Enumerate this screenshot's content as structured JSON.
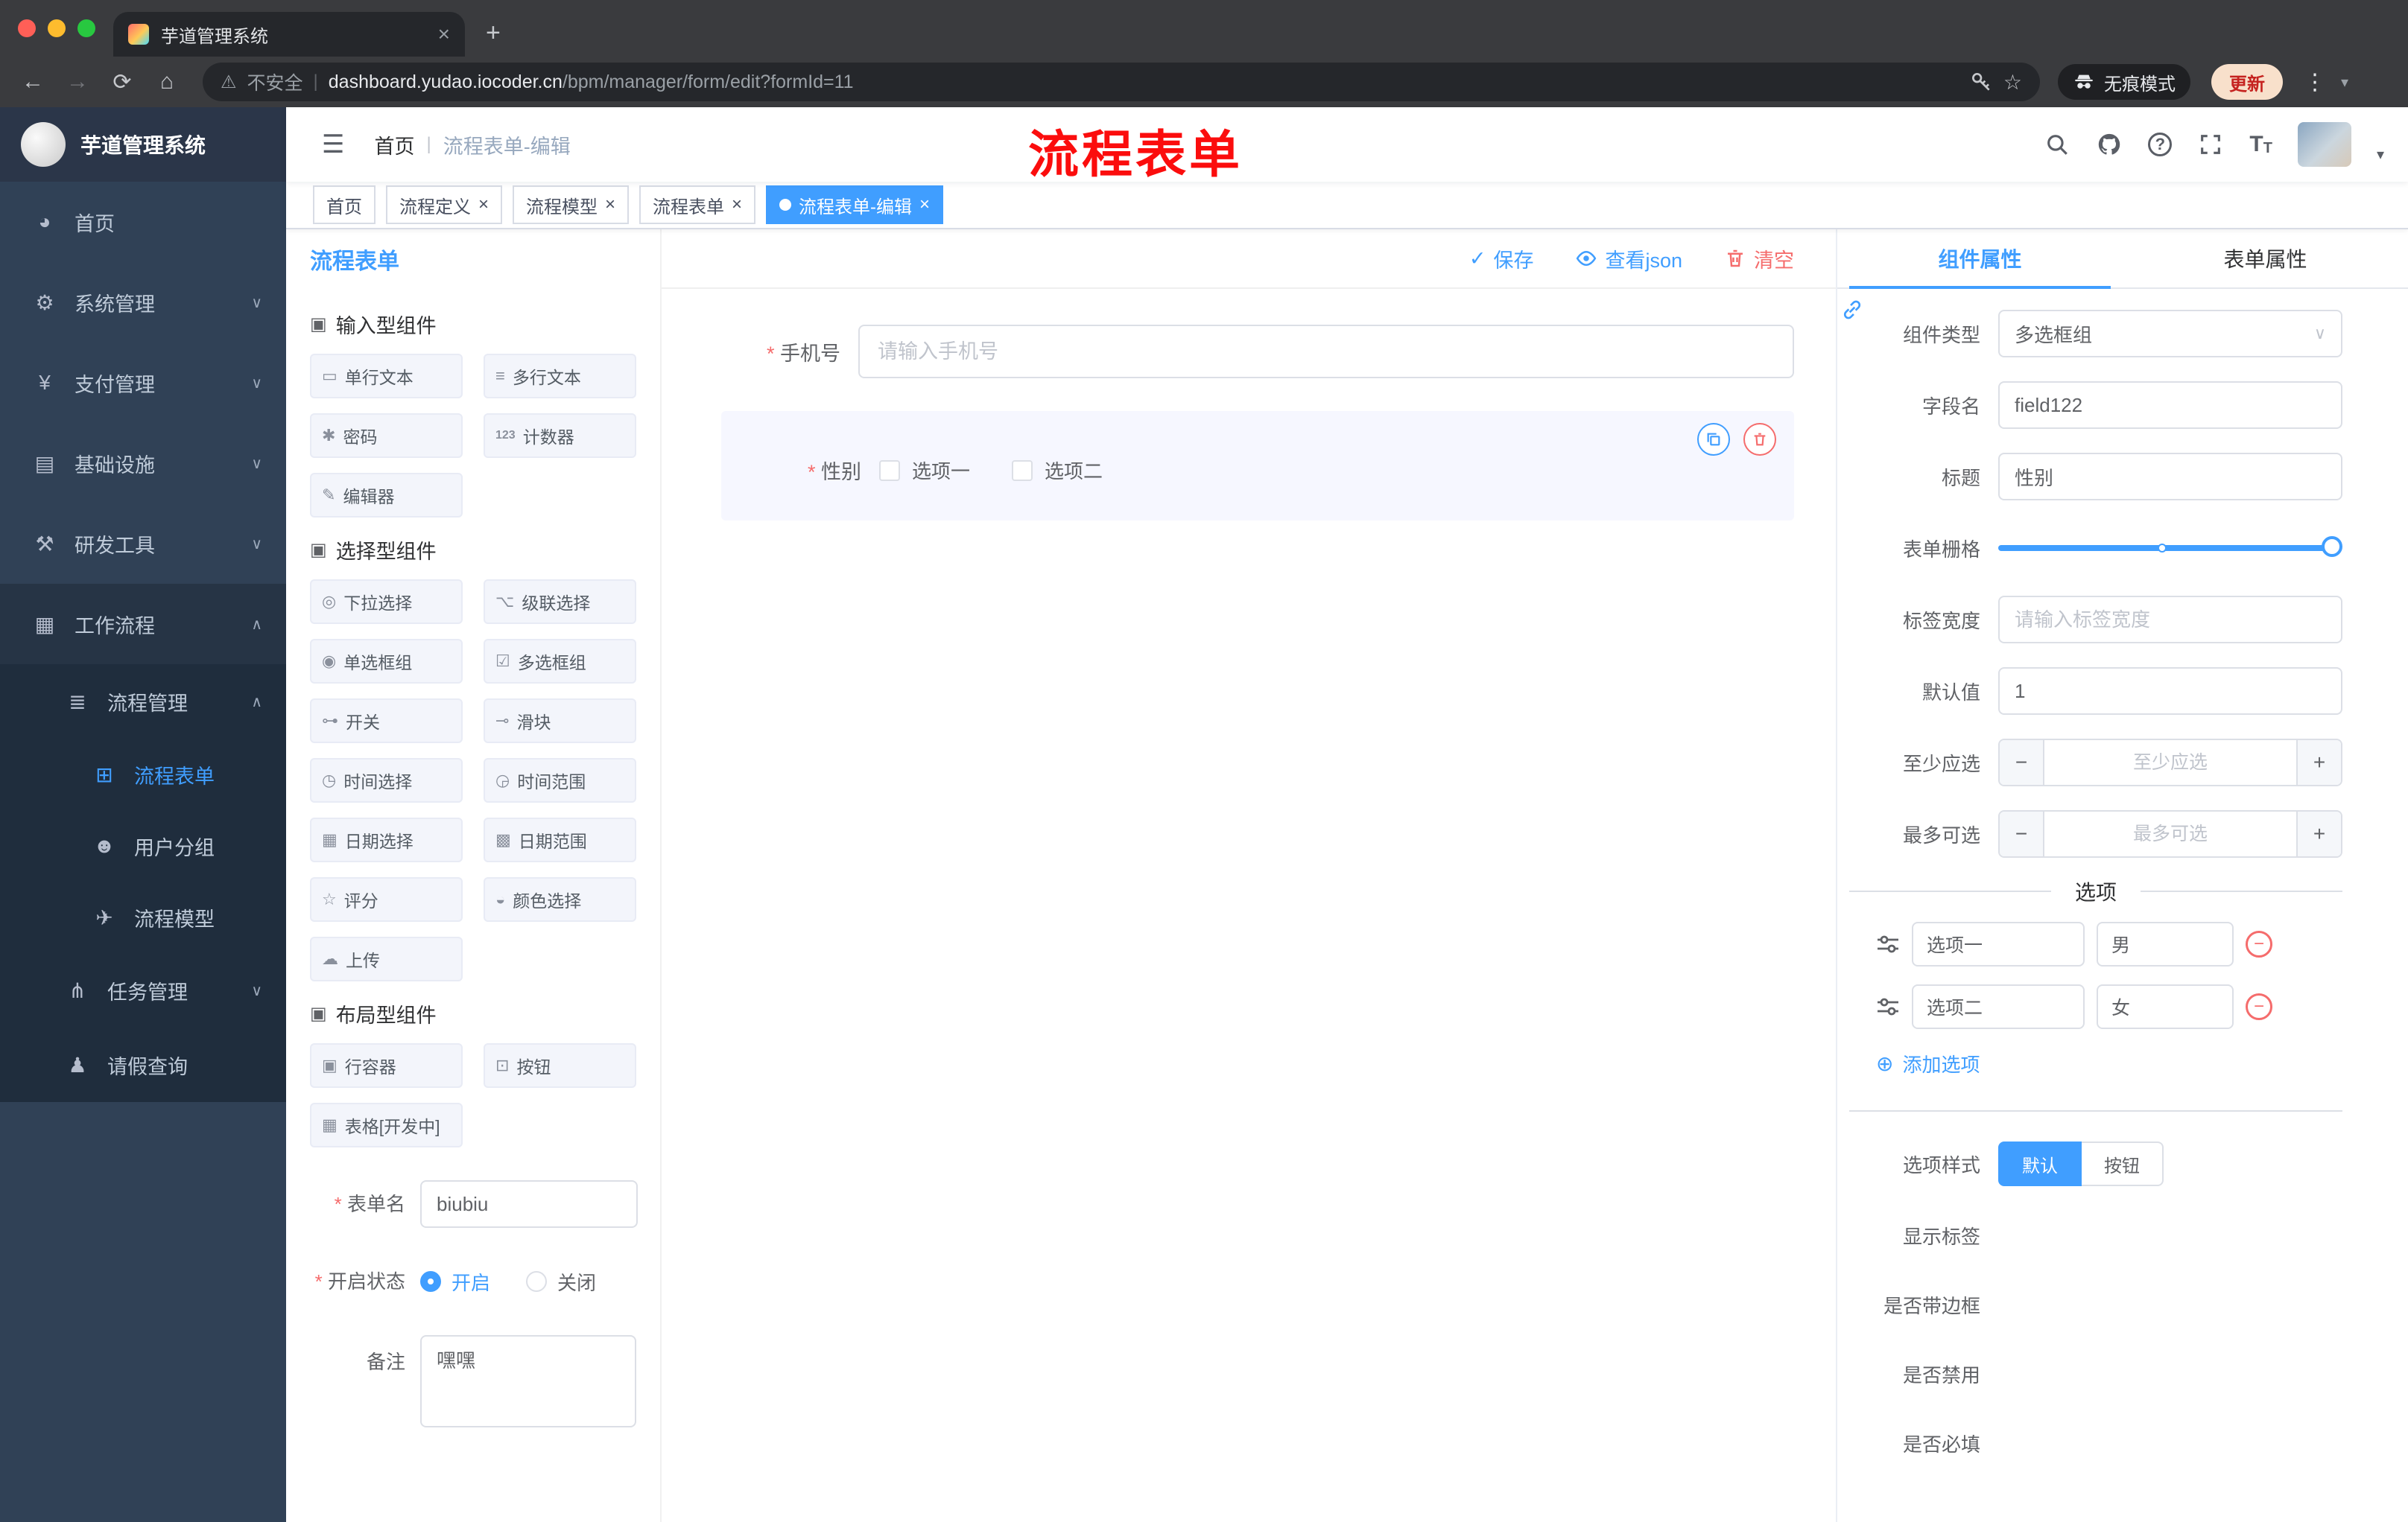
{
  "browser": {
    "tab_title": "芋道管理系统",
    "security_label": "不安全",
    "url_domain": "dashboard.yudao.iocoder.cn",
    "url_path": "/bpm/manager/form/edit?formId=11",
    "incognito_label": "无痕模式",
    "update_label": "更新"
  },
  "icons": {
    "hamburger": "☰",
    "back": "←",
    "forward": "→",
    "reload": "⟳",
    "home": "⌂",
    "warning": "⚠",
    "star": "☆",
    "dots": "⋮",
    "caret_down": "▾",
    "chevron_down": "∨",
    "chevron_up": "∧",
    "close": "×",
    "check": "✓",
    "divider": "|",
    "plus": "+",
    "minus": "−",
    "question": "?",
    "font_size_big": "T",
    "font_size_small": "T",
    "sel_caret": "▼",
    "dashboard": "◕",
    "gear": "⚙",
    "yen": "¥",
    "infra": "▤",
    "tools": "⚒",
    "workflow": "▦",
    "list": "≣",
    "form": "⊞",
    "chat": "☻",
    "send": "✈",
    "tree": "⋔",
    "person": "♟",
    "component": "▣",
    "single_text": "▭",
    "multi_text": "≡",
    "password": "✱",
    "counter": "123",
    "editor": "✎",
    "dropdown": "◎",
    "cascade": "⌥",
    "radio": "◉",
    "checkbox": "☑",
    "switch": "⊶",
    "slider": "⊸",
    "time": "◷",
    "time_range": "◶",
    "date": "▦",
    "date_range": "▩",
    "rate": "☆",
    "color": "◒",
    "upload": "☁",
    "row_container": "▣",
    "button": "⊡",
    "table": "▦",
    "plus_circle": "⊕"
  },
  "sidebar": {
    "logo_title": "芋道管理系统",
    "items": [
      {
        "label": "首页"
      },
      {
        "label": "系统管理"
      },
      {
        "label": "支付管理"
      },
      {
        "label": "基础设施"
      },
      {
        "label": "研发工具"
      },
      {
        "label": "工作流程"
      },
      {
        "label": "流程管理"
      },
      {
        "label": "流程表单"
      },
      {
        "label": "用户分组"
      },
      {
        "label": "流程模型"
      },
      {
        "label": "任务管理"
      },
      {
        "label": "请假查询"
      }
    ]
  },
  "header": {
    "breadcrumb_home": "首页",
    "breadcrumb_current": "流程表单-编辑",
    "annotation": "流程表单"
  },
  "tags": {
    "items": [
      {
        "label": "首页"
      },
      {
        "label": "流程定义"
      },
      {
        "label": "流程模型"
      },
      {
        "label": "流程表单"
      },
      {
        "label": "流程表单-编辑"
      }
    ]
  },
  "designer": {
    "panel_title": "流程表单",
    "groups": [
      {
        "title": "输入型组件",
        "items": [
          "单行文本",
          "多行文本",
          "密码",
          "计数器",
          "编辑器"
        ]
      },
      {
        "title": "选择型组件",
        "items": [
          "下拉选择",
          "级联选择",
          "单选框组",
          "多选框组",
          "开关",
          "滑块",
          "时间选择",
          "时间范围",
          "日期选择",
          "日期范围",
          "评分",
          "颜色选择",
          "上传"
        ]
      },
      {
        "title": "布局型组件",
        "items": [
          "行容器",
          "按钮",
          "表格[开发中]"
        ]
      }
    ],
    "meta": {
      "name_label": "表单名",
      "name_value": "biubiu",
      "status_label": "开启状态",
      "status_on": "开启",
      "status_off": "关闭",
      "remark_label": "备注",
      "remark_value": "嘿嘿"
    },
    "toolbar": {
      "save": "保存",
      "view_json": "查看json",
      "clear": "清空"
    },
    "canvas": {
      "phone_label": "手机号",
      "phone_placeholder": "请输入手机号",
      "gender_label": "性别",
      "gender_options": [
        "选项一",
        "选项二"
      ]
    }
  },
  "properties": {
    "tab_component": "组件属性",
    "tab_form": "表单属性",
    "type_label": "组件类型",
    "type_value": "多选框组",
    "field_label": "字段名",
    "field_value": "field122",
    "title_label": "标题",
    "title_value": "性别",
    "grid_label": "表单栅格",
    "width_label": "标签宽度",
    "width_placeholder": "请输入标签宽度",
    "default_label": "默认值",
    "default_value": "1",
    "min_label": "至少应选",
    "min_placeholder": "至少应选",
    "max_label": "最多可选",
    "max_placeholder": "最多可选",
    "options_title": "选项",
    "options": [
      {
        "label": "选项一",
        "value": "男"
      },
      {
        "label": "选项二",
        "value": "女"
      }
    ],
    "add_option": "添加选项",
    "style_label": "选项样式",
    "style_default": "默认",
    "style_button": "按钮",
    "toggles": [
      {
        "label": "显示标签",
        "on": true
      },
      {
        "label": "是否带边框",
        "on": false
      },
      {
        "label": "是否禁用",
        "on": false
      },
      {
        "label": "是否必填",
        "on": true
      }
    ]
  },
  "colors": {
    "accent": "#409eff",
    "danger": "#f56c6c",
    "annotation": "#ff0000"
  }
}
